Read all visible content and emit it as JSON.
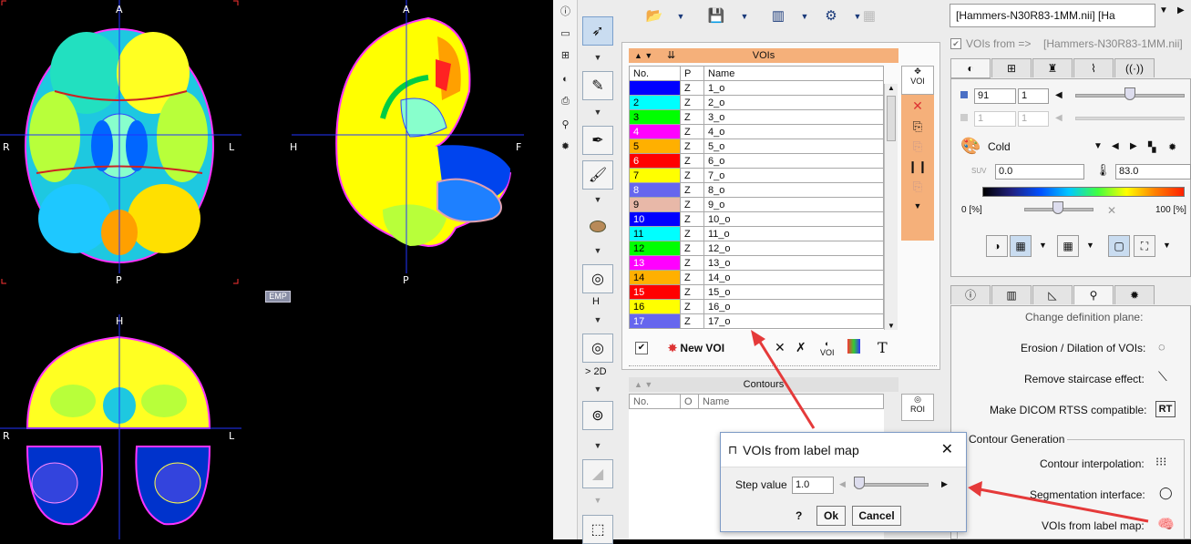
{
  "viewer": {
    "axial": {
      "top": "A",
      "bottom": "P",
      "left": "R",
      "right": "L"
    },
    "sagittal": {
      "top": "A",
      "bottom": "P",
      "left": "H",
      "right": "F"
    },
    "coronal": {
      "top": "H",
      "left": "R",
      "right": "L"
    },
    "emp_badge": "EMP"
  },
  "left_toolbar": {
    "icons": [
      "info-icon",
      "layout-icon",
      "fusion-icon",
      "contrast-icon",
      "print-icon",
      "marker-icon",
      "settings-icon"
    ]
  },
  "mid_toolbar": {
    "tools": [
      "pointer-tool-icon",
      "voi-edit-icon",
      "pen-icon",
      "brush-icon",
      "ellipsoid-icon",
      "contour-2d-icon",
      "segmentation-icon",
      "eraser-icon",
      "box-icon"
    ],
    "label_h": "H",
    "label_2d": "> 2D"
  },
  "top_toolbar": {
    "icons": [
      "open-icon",
      "save-icon",
      "histogram-icon",
      "tools-icon",
      "disabled-icon"
    ]
  },
  "vois_panel": {
    "title": "VOIs",
    "columns": [
      "No.",
      "P",
      "Name"
    ],
    "rows": [
      {
        "no": "",
        "p": "Z",
        "name": "1_o",
        "color": "#0000ff"
      },
      {
        "no": "2",
        "p": "Z",
        "name": "2_o",
        "color": "#00ffff"
      },
      {
        "no": "3",
        "p": "Z",
        "name": "3_o",
        "color": "#00ff00"
      },
      {
        "no": "4",
        "p": "Z",
        "name": "4_o",
        "color": "#ff00ff"
      },
      {
        "no": "5",
        "p": "Z",
        "name": "5_o",
        "color": "#ffb000"
      },
      {
        "no": "6",
        "p": "Z",
        "name": "6_o",
        "color": "#ff0000"
      },
      {
        "no": "7",
        "p": "Z",
        "name": "7_o",
        "color": "#ffff00"
      },
      {
        "no": "8",
        "p": "Z",
        "name": "8_o",
        "color": "#6666ee"
      },
      {
        "no": "9",
        "p": "Z",
        "name": "9_o",
        "color": "#e8b8a8"
      },
      {
        "no": "10",
        "p": "Z",
        "name": "10_o",
        "color": "#0000ff"
      },
      {
        "no": "11",
        "p": "Z",
        "name": "11_o",
        "color": "#00ffff"
      },
      {
        "no": "12",
        "p": "Z",
        "name": "12_o",
        "color": "#00ff00"
      },
      {
        "no": "13",
        "p": "Z",
        "name": "13_o",
        "color": "#ff00ff"
      },
      {
        "no": "14",
        "p": "Z",
        "name": "14_o",
        "color": "#ffb000"
      },
      {
        "no": "15",
        "p": "Z",
        "name": "15_o",
        "color": "#ff0000"
      },
      {
        "no": "16",
        "p": "Z",
        "name": "16_o",
        "color": "#ffff00"
      },
      {
        "no": "17",
        "p": "Z",
        "name": "17_o",
        "color": "#6666ee"
      }
    ],
    "new_voi_label": "New VOI",
    "voi_button": "VOI"
  },
  "contours_panel": {
    "title": "Contours",
    "columns": [
      "No.",
      "O",
      "Name"
    ],
    "roi_button": "ROI"
  },
  "right": {
    "series_select": "[Hammers-N30R83-1MM.nii] [Ha",
    "vois_from_label": "VOIs from =>",
    "vois_from_value": "[Hammers-N30R83-1MM.nii]",
    "slice_a": "91",
    "slice_b": "1",
    "slice_c": "1",
    "slice_d": "1",
    "colortable": "Cold",
    "range_min": "0.0",
    "range_max": "83.0",
    "pct_min": "0 [%]",
    "pct_max": "100 [%]",
    "suv_label": "SUV",
    "change_def_plane": "Change definition plane:",
    "erosion": "Erosion / Dilation of VOIs:",
    "staircase": "Remove staircase effect:",
    "dicom_rtss": "Make DICOM RTSS compatible:",
    "rt_button": "RT",
    "contour_gen": "Contour Generation",
    "contour_interp": "Contour interpolation:",
    "segmentation_if": "Segmentation interface:",
    "vois_from_labelmap": "VOIs from label map:"
  },
  "dialog": {
    "title": "VOIs from label map",
    "step_label": "Step value",
    "step_value": "1.0",
    "help": "?",
    "ok": "Ok",
    "cancel": "Cancel"
  }
}
